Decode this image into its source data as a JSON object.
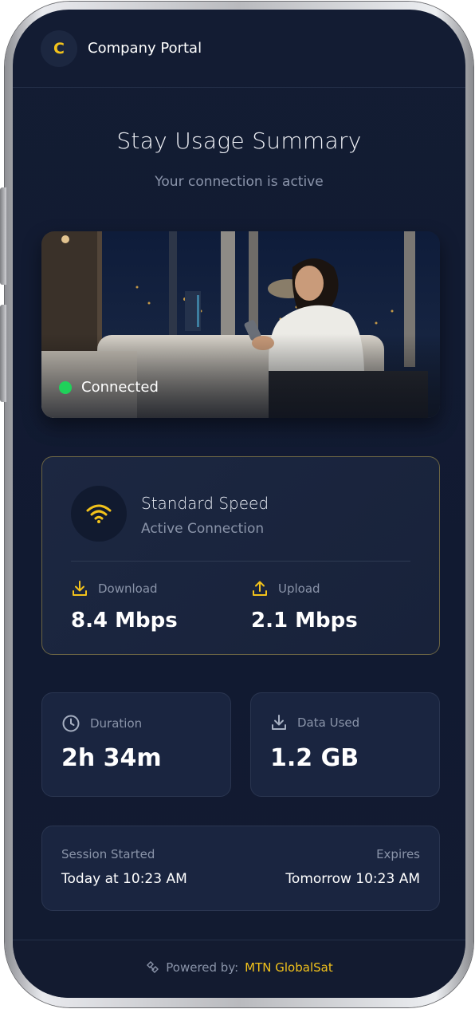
{
  "header": {
    "logo_letter": "C",
    "app_title": "Company Portal"
  },
  "main": {
    "title": "Stay Usage Summary",
    "subtitle": "Your connection is active"
  },
  "hero": {
    "status_label": "Connected",
    "status_color": "#1fd15a"
  },
  "speed_card": {
    "title": "Standard Speed",
    "subtitle": "Active Connection",
    "download_label": "Download",
    "download_value": "8.4 Mbps",
    "upload_label": "Upload",
    "upload_value": "2.1 Mbps",
    "icon": "wifi-icon"
  },
  "stats": {
    "duration_label": "Duration",
    "duration_value": "2h 34m",
    "data_label": "Data Used",
    "data_value": "1.2 GB"
  },
  "session": {
    "started_label": "Session Started",
    "started_value": "Today at 10:23 AM",
    "expires_label": "Expires",
    "expires_value": "Tomorrow 10:23 AM"
  },
  "footer": {
    "label": "Powered by:",
    "brand": "MTN GlobalSat"
  },
  "colors": {
    "accent": "#f2c21b",
    "background": "#131c33",
    "card": "#1a2540"
  }
}
